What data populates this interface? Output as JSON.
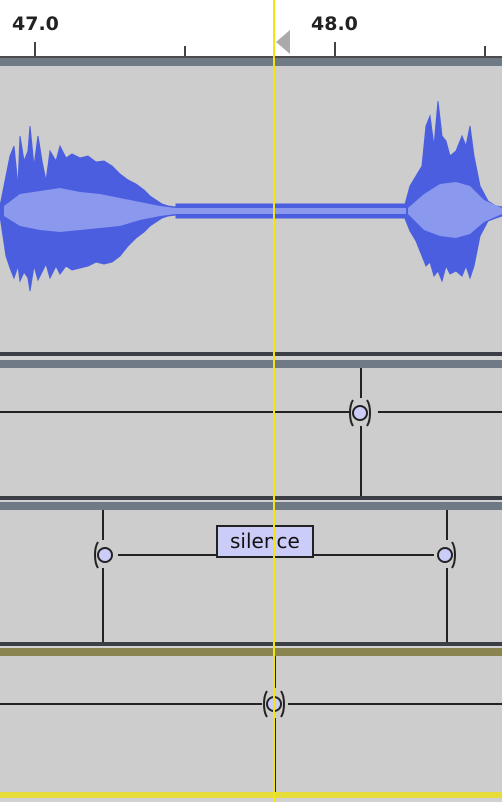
{
  "ruler": {
    "labels": [
      "47.0",
      "48.0"
    ]
  },
  "label_tracks": {
    "track2_label": "silence"
  },
  "colors": {
    "waveform": "#4b5ee0",
    "waveform_core": "#8a98ee",
    "cursor": "#f3e60e",
    "label_fill": "#ccccf8",
    "track_bg": "#cdcdcd"
  }
}
